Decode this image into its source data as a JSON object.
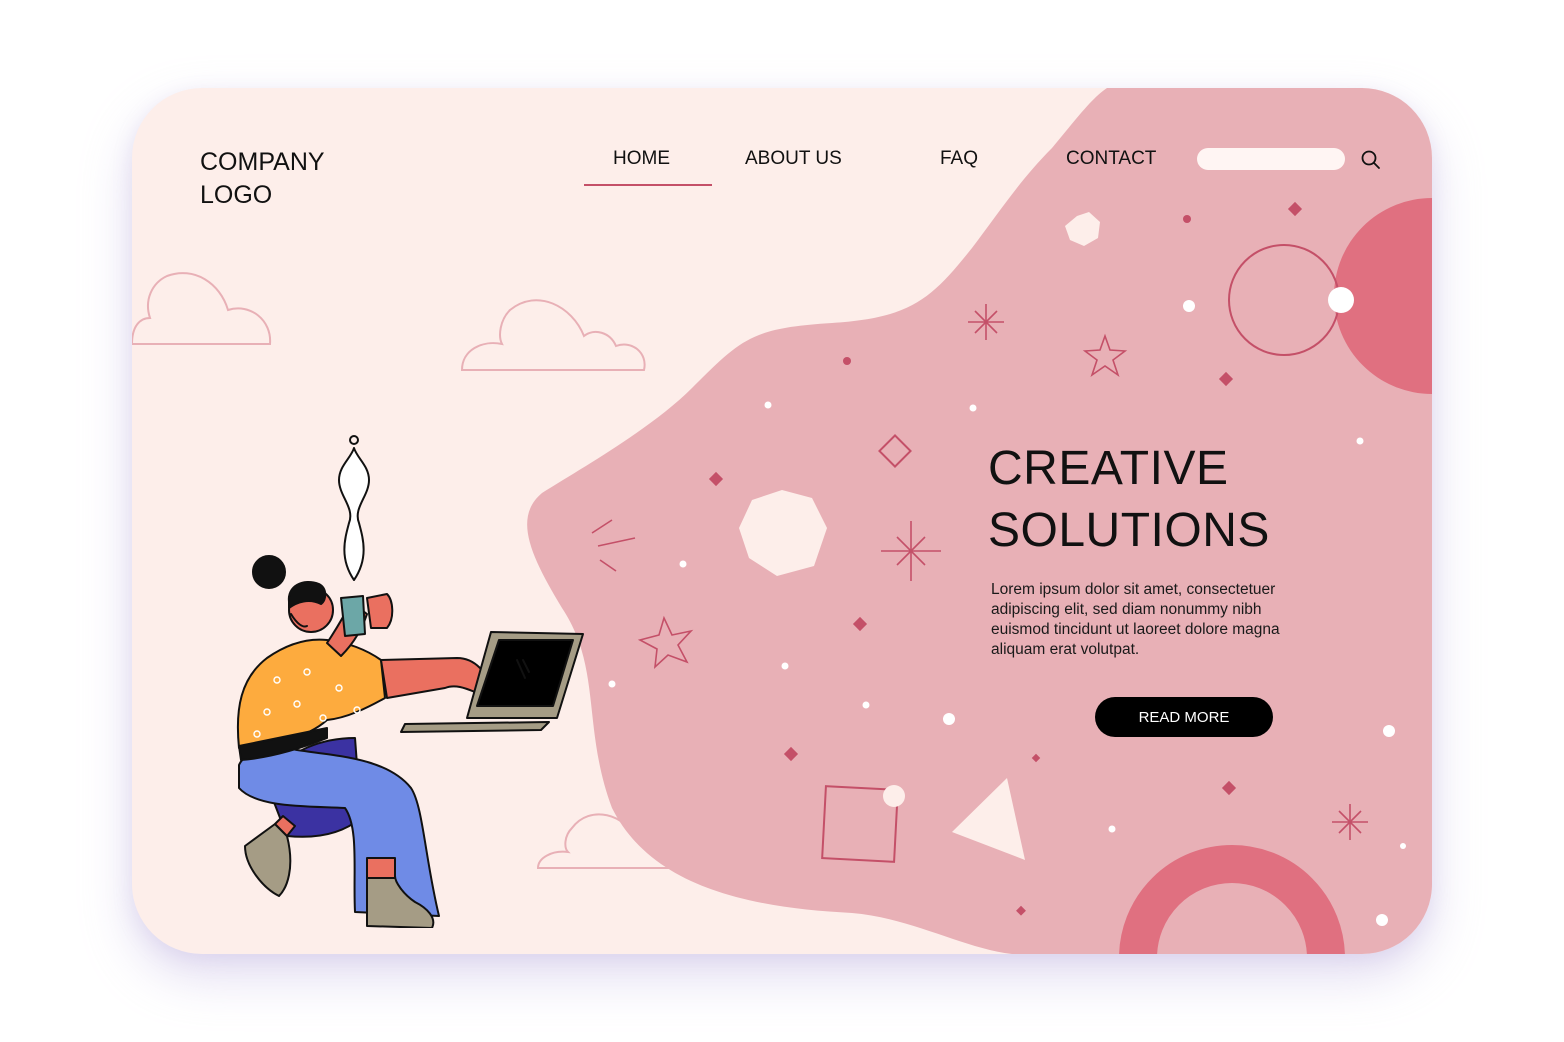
{
  "logo": {
    "text": "COMPANY\nLOGO"
  },
  "nav": {
    "items": [
      {
        "label": "HOME",
        "active": true
      },
      {
        "label": "ABOUT US",
        "active": false
      },
      {
        "label": "FAQ",
        "active": false
      },
      {
        "label": "CONTACT",
        "active": false
      }
    ]
  },
  "search": {
    "placeholder": "",
    "value": "",
    "icon": "search-icon"
  },
  "hero": {
    "title": "CREATIVE\nSOLUTIONS",
    "body": "Lorem ipsum dolor sit amet, consectetuer adipiscing elit, sed diam nonummy nibh euismod tincidunt ut laoreet dolore magna aliquam erat volutpat.",
    "button_label": "READ MORE"
  },
  "colors": {
    "background": "#fdeeea",
    "blob": "#e8b0b6",
    "accent": "#e07080",
    "line": "#c45068",
    "button": "#000000"
  }
}
